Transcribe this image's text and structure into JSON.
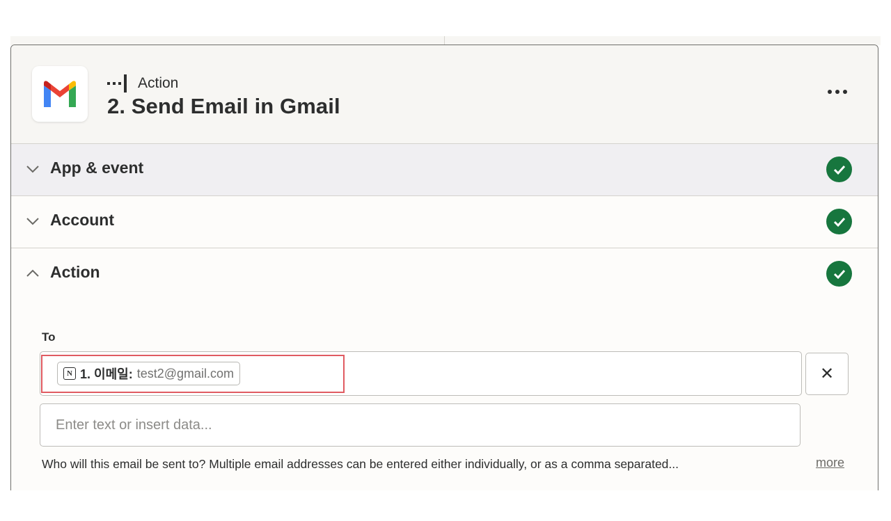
{
  "step": {
    "kind_label": "Action",
    "title": "2. Send Email in Gmail",
    "app_icon": "gmail-icon",
    "menu_icon": "more-horizontal-icon"
  },
  "sections": {
    "app_event": {
      "label": "App & event",
      "state": "collapsed",
      "complete": true
    },
    "account": {
      "label": "Account",
      "state": "collapsed",
      "complete": true
    },
    "action": {
      "label": "Action",
      "state": "expanded",
      "complete": true
    }
  },
  "to_field": {
    "label": "To",
    "pill": {
      "icon": "notion-icon",
      "key": "1. 이메일:",
      "value": "test2@gmail.com"
    },
    "clear_icon": "close-icon",
    "clear_glyph": "✕",
    "input_placeholder": "Enter text or insert data...",
    "help_text": "Who will this email be sent to? Multiple email addresses can be entered either individually, or as a comma separated...",
    "more_label": "more"
  },
  "colors": {
    "check_green": "#17763e",
    "highlight_red": "#e05b61",
    "header_bg": "#f7f6f3",
    "selected_section_bg": "#f0eff2"
  }
}
